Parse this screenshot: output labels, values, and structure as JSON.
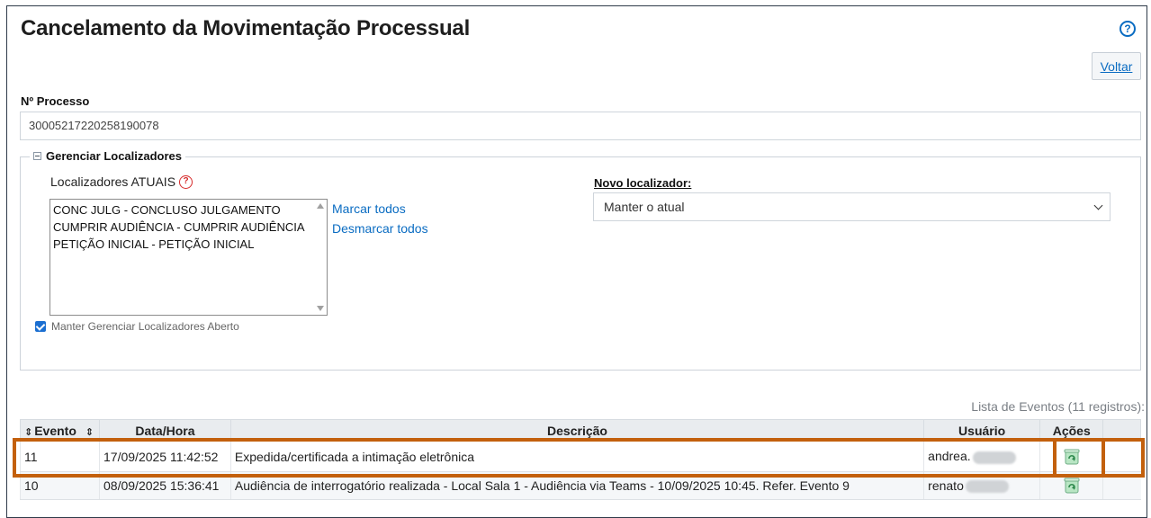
{
  "page": {
    "title": "Cancelamento da Movimentação Processual",
    "help_glyph": "?",
    "voltar_label": "Voltar"
  },
  "processo": {
    "label": "Nº Processo",
    "value": "30005217220258190078"
  },
  "localizadores": {
    "legend": "Gerenciar Localizadores",
    "atuais_label": "Localizadores ATUAIS",
    "help_glyph": "?",
    "options": [
      "CONC JULG - CONCLUSO JULGAMENTO",
      "CUMPRIR AUDIÊNCIA - CUMPRIR AUDIÊNCIA",
      "PETIÇÃO INICIAL - PETIÇÃO INICIAL"
    ],
    "marcar_todos": "Marcar todos",
    "desmarcar_todos": "Desmarcar todos",
    "novo_label": "Novo localizador:",
    "novo_selected": "Manter o atual",
    "manter_aberto_label": "Manter Gerenciar Localizadores Aberto",
    "manter_aberto_checked": true
  },
  "eventos": {
    "caption": "Lista de Eventos (11 registros):",
    "sort_glyph": "⇕",
    "columns": [
      "Evento",
      "Data/Hora",
      "Descrição",
      "Usuário",
      "Ações"
    ],
    "rows": [
      {
        "evento": "11",
        "data_hora": "17/09/2025 11:42:52",
        "descricao": "Expedida/certificada a intimação eletrônica",
        "usuario": "andrea.",
        "acao_icon": "recycle-icon"
      },
      {
        "evento": "10",
        "data_hora": "08/09/2025 15:36:41",
        "descricao": "Audiência de interrogatório realizada - Local Sala 1 - Audiência via Teams - 10/09/2025 10:45. Refer. Evento 9",
        "usuario": "renato",
        "acao_icon": "recycle-icon"
      }
    ]
  },
  "colors": {
    "link": "#0a6cc2",
    "highlight": "#c3600d",
    "help_red": "#d62a2a",
    "header_bg": "#e9ecef"
  }
}
